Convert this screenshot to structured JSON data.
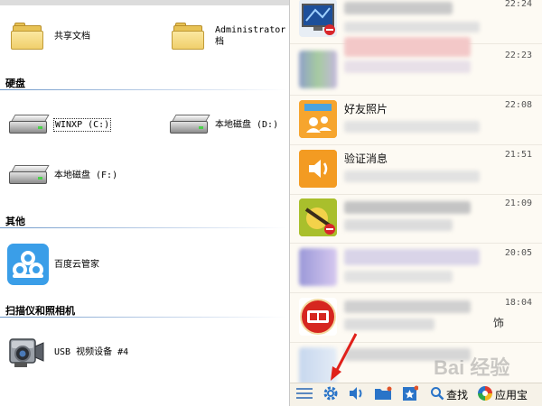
{
  "explorer": {
    "folders": [
      {
        "label": "共享文档"
      },
      {
        "label_line1": "Administrator",
        "label_line2": "档"
      }
    ],
    "sections": {
      "drives": "硬盘",
      "other": "其他",
      "scanners": "扫描仪和照相机"
    },
    "drives": [
      {
        "label": "WINXP (C:)"
      },
      {
        "label": "本地磁盘 (D:)"
      },
      {
        "label": "本地磁盘 (F:)"
      }
    ],
    "other_items": [
      {
        "label": "百度云管家"
      }
    ],
    "devices": [
      {
        "label": "USB 视频设备 #4"
      }
    ]
  },
  "chat": {
    "rows": [
      {
        "title": "",
        "time": "22:24",
        "avatar": "monitor-avatar"
      },
      {
        "title": "",
        "time": "22:23",
        "avatar": "blurred-avatar"
      },
      {
        "title": "好友照片",
        "time": "22:08",
        "avatar": "friend-photos-icon"
      },
      {
        "title": "验证消息",
        "time": "21:51",
        "avatar": "speaker-icon"
      },
      {
        "title": "",
        "time": "21:09",
        "avatar": "game-avatar"
      },
      {
        "title": "",
        "time": "20:05",
        "avatar": "blurred-avatar"
      },
      {
        "title": "",
        "time": "18:04",
        "avatar": "jingbao-avatar",
        "extra": "饰"
      },
      {
        "title": "",
        "time": "",
        "avatar": "blurred-avatar"
      }
    ],
    "toolbar": {
      "search_label": "查找",
      "appstore_label": "应用宝"
    }
  },
  "watermark": "Bai 经验",
  "colors": {
    "section_line": "#6b96c8",
    "chat_bg": "#fdfaf3",
    "folder": "#f0cf6c",
    "baidu_blue": "#3a9ee8",
    "toolbar_icon": "#2a74c8",
    "annotation_arrow": "#e0201a"
  }
}
